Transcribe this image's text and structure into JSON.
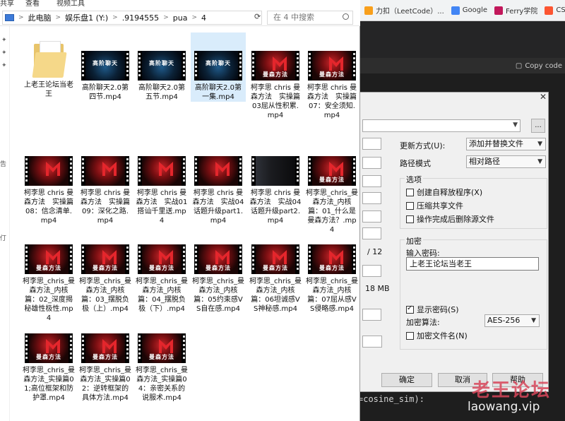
{
  "browser": {
    "bookmarks": [
      {
        "label": "力扣（LeetCode）...",
        "icon": "leetcode-icon",
        "color": "#f89f1b"
      },
      {
        "label": "Google",
        "icon": "google-icon",
        "color": "#4285f4"
      },
      {
        "label": "Ferry学院",
        "icon": "ferry-icon",
        "color": "#c2185b"
      },
      {
        "label": "CSDN",
        "icon": "csdn-icon",
        "color": "#fc5531"
      }
    ]
  },
  "editor": {
    "copy_label": "Copy code",
    "code_line": "=cosine_sim):"
  },
  "watermark": {
    "cn": "老王论坛",
    "en": "laowang.vip"
  },
  "explorer": {
    "ribbon": [
      "共享",
      "查看",
      "视频工具"
    ],
    "breadcrumb": [
      "此电脑",
      "娱乐盘1 (Y:)",
      ".9194555",
      "pua",
      "4"
    ],
    "search_placeholder": "在 4 中搜索",
    "side_fragments": [
      "告",
      "仃"
    ],
    "items": [
      {
        "name": "上老王论坛当老王",
        "type": "folder"
      },
      {
        "name": "高阶聊天2.0第四节.mp4",
        "type": "video",
        "scene": "blue",
        "thumb_text": "高阶聊天"
      },
      {
        "name": "高阶聊天2.0第五节.mp4",
        "type": "video",
        "scene": "blue",
        "thumb_text": "高阶聊天"
      },
      {
        "name": "高阶聊天2.0第一集.mp4",
        "type": "video",
        "scene": "blue",
        "thumb_text": "高阶聊天",
        "selected": true
      },
      {
        "name": "柯李思 chris 曼森方法　实操篇03屈从性积累.mp4",
        "type": "video",
        "scene": "red",
        "thumb_text": "曼森方法"
      },
      {
        "name": "柯李思 chris 曼森方法　实操篇07：安全须知.mp4",
        "type": "video",
        "scene": "red",
        "thumb_text": "曼森方法"
      },
      {
        "name": "柯李思 chris 曼森方法　实操篇08：信念清单.mp4",
        "type": "video",
        "scene": "red",
        "thumb_text": ""
      },
      {
        "name": "柯李思 chris 曼森方法　实操篇09：深化之路.mp4",
        "type": "video",
        "scene": "red",
        "thumb_text": ""
      },
      {
        "name": "柯李思 chris 曼森方法　实战01搭讪千里送.mp4",
        "type": "video",
        "scene": "red",
        "thumb_text": ""
      },
      {
        "name": "柯李思 chris 曼森方法　实战04话题升级part1.mp4",
        "type": "video",
        "scene": "red",
        "thumb_text": ""
      },
      {
        "name": "柯李思 chris 曼森方法　实战04话题升级part2.mp4",
        "type": "video",
        "scene": "dark",
        "thumb_text": ""
      },
      {
        "name": "柯李思_chris_曼森方法_内核篇：01_什么是曼森方法？.mp4",
        "type": "video",
        "scene": "red",
        "thumb_text": "曼森方法"
      },
      {
        "name": "柯李思_chris_曼森方法_内核篇：02_深度揭秘雄性极性.mp4",
        "type": "video",
        "scene": "red",
        "thumb_text": "曼森方法"
      },
      {
        "name": "柯李思_chris_曼森方法_内核篇：03_摆脱负极（上）.mp4",
        "type": "video",
        "scene": "red",
        "thumb_text": "曼森方法"
      },
      {
        "name": "柯李思_chris_曼森方法_内核篇：04_摆脱负极（下）.mp4",
        "type": "video",
        "scene": "red",
        "thumb_text": "曼森方法"
      },
      {
        "name": "柯李思_chris_曼森方法_内核篇：05约束感VS自在感.mp4",
        "type": "video",
        "scene": "red",
        "thumb_text": "曼森方法"
      },
      {
        "name": "柯李思_chris_曼森方法_内核篇：06坦诚感VS神秘感.mp4",
        "type": "video",
        "scene": "red",
        "thumb_text": "曼森方法"
      },
      {
        "name": "柯李思_chris_曼森方法_内核篇：07屈从感VS侵略感.mp4",
        "type": "video",
        "scene": "red",
        "thumb_text": "曼森方法"
      },
      {
        "name": "柯李思_chris_曼森方法_实操篇01;高位框架和防护罩.mp4",
        "type": "video",
        "scene": "red",
        "thumb_text": "曼森方法"
      },
      {
        "name": "柯李思_chris_曼森方法_实操篇02：逆转框架的具体方法.mp4",
        "type": "video",
        "scene": "red",
        "thumb_text": "曼森方法"
      },
      {
        "name": "柯李思_chris_曼森方法_实操篇04：亲密关系的说服术.mp4",
        "type": "video",
        "scene": "red",
        "thumb_text": "曼森方法"
      }
    ]
  },
  "dialog": {
    "update_mode_label": "更新方式(U):",
    "update_mode_value": "添加并替换文件",
    "path_mode_label": "路径模式",
    "path_mode_value": "相对路径",
    "options_title": "选项",
    "options": [
      {
        "label": "创建自释放程序(X)",
        "checked": false
      },
      {
        "label": "压缩共享文件",
        "checked": false
      },
      {
        "label": "操作完成后删除源文件",
        "checked": false
      }
    ],
    "encrypt_title": "加密",
    "password_label": "输入密码:",
    "password_value": "上老王论坛当老王",
    "show_password_label": "显示密码(S)",
    "show_password_checked": true,
    "algo_label": "加密算法:",
    "algo_value": "AES-256",
    "encrypt_names_label": "加密文件名(N)",
    "encrypt_names_checked": false,
    "side_count": "/ 12",
    "side_size": "18 MB",
    "browse_label": "...",
    "buttons": {
      "ok": "确定",
      "cancel": "取消",
      "help": "帮助"
    }
  }
}
